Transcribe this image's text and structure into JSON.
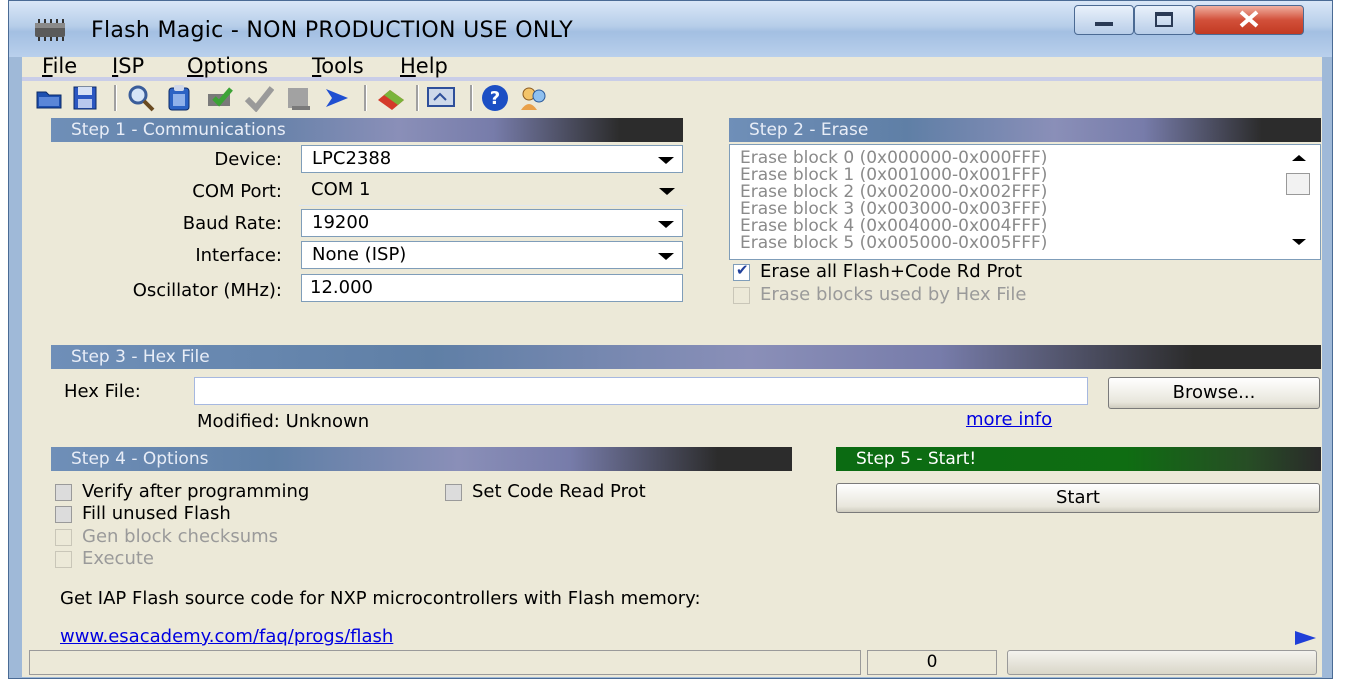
{
  "window": {
    "title": "Flash Magic - NON PRODUCTION USE ONLY"
  },
  "menu": [
    "File",
    "ISP",
    "Options",
    "Tools",
    "Help"
  ],
  "toolbar": [
    "open-file",
    "save",
    "search",
    "clipboard",
    "program",
    "verify",
    "blank-check",
    "go",
    "erase",
    "screen",
    "help",
    "users"
  ],
  "step1": {
    "title": "Step 1 - Communications",
    "device_label": "Device:",
    "device_value": "LPC2388",
    "com_label": "COM Port:",
    "com_value": "COM 1",
    "baud_label": "Baud Rate:",
    "baud_value": "19200",
    "interface_label": "Interface:",
    "interface_value": "None (ISP)",
    "osc_label": "Oscillator (MHz):",
    "osc_value": "12.000"
  },
  "step2": {
    "title": "Step 2 - Erase",
    "blocks": [
      "Erase block 0 (0x000000-0x000FFF)",
      "Erase block 1 (0x001000-0x001FFF)",
      "Erase block 2 (0x002000-0x002FFF)",
      "Erase block 3 (0x003000-0x003FFF)",
      "Erase block 4 (0x004000-0x004FFF)",
      "Erase block 5 (0x005000-0x005FFF)"
    ],
    "erase_all_label": "Erase all Flash+Code Rd Prot",
    "erase_all_checked": true,
    "erase_hex_label": "Erase blocks used by Hex File"
  },
  "step3": {
    "title": "Step 3 - Hex File",
    "hex_label": "Hex File:",
    "hex_value": "",
    "browse_label": "Browse...",
    "modified": "Modified: Unknown",
    "more_info": "more info"
  },
  "step4": {
    "title": "Step 4 - Options",
    "verify_label": "Verify after programming",
    "code_read_label": "Set Code Read Prot",
    "fill_label": "Fill unused Flash",
    "gen_label": "Gen block checksums",
    "execute_label": "Execute"
  },
  "step5": {
    "title": "Step 5 - Start!",
    "start_label": "Start"
  },
  "info": {
    "text": "Get IAP Flash source code for NXP microcontrollers with Flash memory:",
    "link": "www.esacademy.com/faq/progs/flash"
  },
  "status": {
    "main": "",
    "count": "0",
    "progress": 0
  },
  "colors": {
    "banner_blue": "#6f8fb8",
    "banner_green": "#0b6b12",
    "link": "#0000e0"
  }
}
